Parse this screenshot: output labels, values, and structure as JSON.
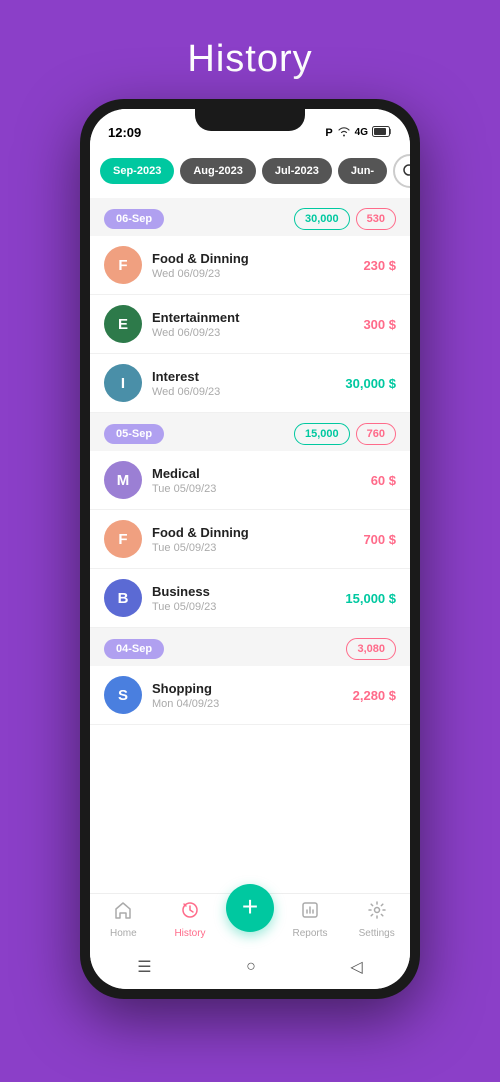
{
  "page": {
    "title": "History",
    "bg_color": "#8B3FC8"
  },
  "status_bar": {
    "time": "12:09",
    "icon_p": "P",
    "wifi": "WiFi",
    "signal": "4G",
    "battery": "80"
  },
  "month_tabs": [
    {
      "id": "sep2023",
      "label": "Sep-2023",
      "state": "active"
    },
    {
      "id": "aug2023",
      "label": "Aug-2023",
      "state": "inactive"
    },
    {
      "id": "jul2023",
      "label": "Jul-2023",
      "state": "inactive"
    },
    {
      "id": "jun2023",
      "label": "Jun-",
      "state": "partial"
    }
  ],
  "date_sections": [
    {
      "id": "sep06",
      "date_label": "06-Sep",
      "total_income": "30,000",
      "total_expense": "530",
      "transactions": [
        {
          "id": "t1",
          "avatar_letter": "F",
          "avatar_color": "#f0a080",
          "name": "Food & Dinning",
          "date": "Wed 06/09/23",
          "amount": "230 $",
          "type": "expense"
        },
        {
          "id": "t2",
          "avatar_letter": "E",
          "avatar_color": "#2d7a4a",
          "name": "Entertainment",
          "date": "Wed 06/09/23",
          "amount": "300 $",
          "type": "expense"
        },
        {
          "id": "t3",
          "avatar_letter": "I",
          "avatar_color": "#4a8fa8",
          "name": "Interest",
          "date": "Wed 06/09/23",
          "amount": "30,000 $",
          "type": "income"
        }
      ]
    },
    {
      "id": "sep05",
      "date_label": "05-Sep",
      "total_income": "15,000",
      "total_expense": "760",
      "transactions": [
        {
          "id": "t4",
          "avatar_letter": "M",
          "avatar_color": "#9b7fd4",
          "name": "Medical",
          "date": "Tue 05/09/23",
          "amount": "60 $",
          "type": "expense"
        },
        {
          "id": "t5",
          "avatar_letter": "F",
          "avatar_color": "#f0a080",
          "name": "Food & Dinning",
          "date": "Tue 05/09/23",
          "amount": "700 $",
          "type": "expense"
        },
        {
          "id": "t6",
          "avatar_letter": "B",
          "avatar_color": "#5b6ad4",
          "name": "Business",
          "date": "Tue 05/09/23",
          "amount": "15,000 $",
          "type": "income"
        }
      ]
    },
    {
      "id": "sep04",
      "date_label": "04-Sep",
      "total_expense": "3,080",
      "transactions": [
        {
          "id": "t7",
          "avatar_letter": "S",
          "avatar_color": "#4a7fdf",
          "name": "Shopping",
          "date": "Mon 04/09/23",
          "amount": "2,280 $",
          "type": "expense"
        }
      ]
    }
  ],
  "bottom_nav": {
    "items": [
      {
        "id": "home",
        "label": "Home",
        "active": false
      },
      {
        "id": "history",
        "label": "History",
        "active": true
      },
      {
        "id": "fab",
        "label": "+",
        "is_fab": true
      },
      {
        "id": "reports",
        "label": "Reports",
        "active": false
      },
      {
        "id": "settings",
        "label": "Settings",
        "active": false
      }
    ]
  }
}
